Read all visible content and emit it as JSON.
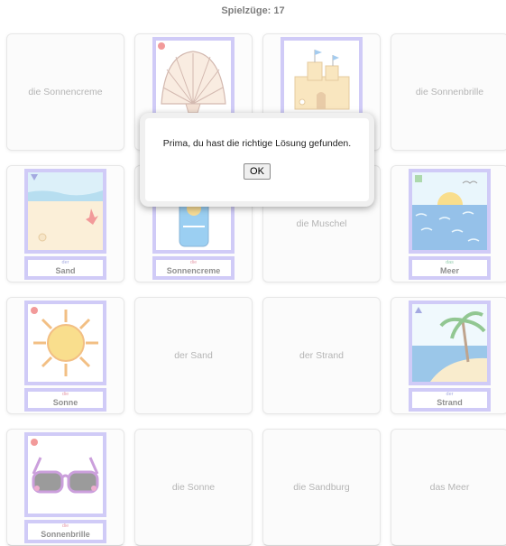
{
  "header": {
    "moves_label": "Spielzüge: 17"
  },
  "cards": {
    "c1": {
      "text": "die Sonnencreme"
    },
    "c4": {
      "text": "die Sonnenbrille"
    },
    "c7": {
      "text": "die Muschel"
    },
    "c10": {
      "text": "der Sand"
    },
    "c11": {
      "text": "der Strand"
    },
    "c14": {
      "text": "die Sonne"
    },
    "c15": {
      "text": "die Sandburg"
    },
    "c16": {
      "text": "das Meer"
    },
    "sand": {
      "article": "der",
      "noun": "Sand"
    },
    "sonnencreme": {
      "article": "die",
      "noun": "Sonnencreme"
    },
    "meer": {
      "article": "das",
      "noun": "Meer"
    },
    "sonne": {
      "article": "die",
      "noun": "Sonne"
    },
    "strand": {
      "article": "der",
      "noun": "Strand"
    },
    "sonnenbrille": {
      "article": "die",
      "noun": "Sonnenbrille"
    }
  },
  "dialog": {
    "message": "Prima, du hast die richtige Lösung gefunden.",
    "ok_label": "OK"
  },
  "icons": {
    "shell": "shell-icon",
    "sandcastle": "sandcastle-icon",
    "sand": "sand-icon",
    "sunscreen": "sunscreen-icon",
    "sea": "sea-icon",
    "sun": "sun-icon",
    "beach": "beach-icon",
    "sunglasses": "sunglasses-icon"
  },
  "colors": {
    "card_border": "#a9a0f0",
    "marker_red": "#e74848",
    "marker_blue": "#5a64c8",
    "marker_green": "#6aba6a"
  }
}
